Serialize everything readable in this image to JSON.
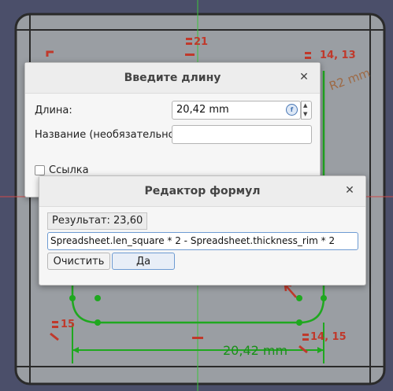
{
  "sketch": {
    "constraint_labels": {
      "c21": "21",
      "c14_13": "14, 13",
      "radius": "R2 mm",
      "c15": "15",
      "c14_15": "14, 15",
      "width_dim": "20,42 mm"
    }
  },
  "length_dialog": {
    "title": "Введите длину",
    "length_label": "Длина:",
    "length_value": "20,42 mm",
    "name_label": "Название (необязательно)",
    "name_value": "",
    "reference_label": "Ссылка"
  },
  "formula_dialog": {
    "title": "Редактор формул",
    "result_text": "Результат: 23,60",
    "expression": "Spreadsheet.len_square * 2 - Spreadsheet.thickness_rim * 2",
    "clear_label": "Очистить",
    "ok_label": "Да"
  },
  "colors": {
    "background": "#4b4f6a",
    "sketch_face": "#9a9ea3",
    "sketch_line": "#1fa81f",
    "constraint": "#c0392b"
  }
}
